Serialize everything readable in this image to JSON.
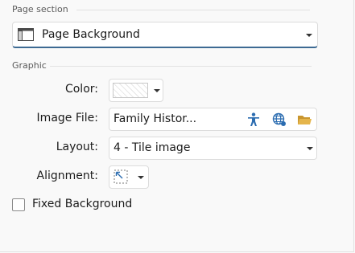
{
  "page_section": {
    "heading": "Page section",
    "selected": "Page Background",
    "icon": "page-background-icon"
  },
  "graphic": {
    "heading": "Graphic",
    "color": {
      "label": "Color:",
      "swatch": "hatched-empty"
    },
    "image_file": {
      "label": "Image File:",
      "value": "Family Histor...",
      "buttons": [
        "person-icon",
        "globe-icon",
        "folder-icon"
      ]
    },
    "layout": {
      "label": "Layout:",
      "value": "4 - Tile image"
    },
    "alignment": {
      "label": "Alignment:",
      "icon": "align-top-left-icon"
    }
  },
  "fixed_background": {
    "label": "Fixed Background",
    "checked": false
  },
  "colors": {
    "accent": "#2b6cb0",
    "folder": "#e5b54b",
    "underline": "#3d6a93"
  }
}
